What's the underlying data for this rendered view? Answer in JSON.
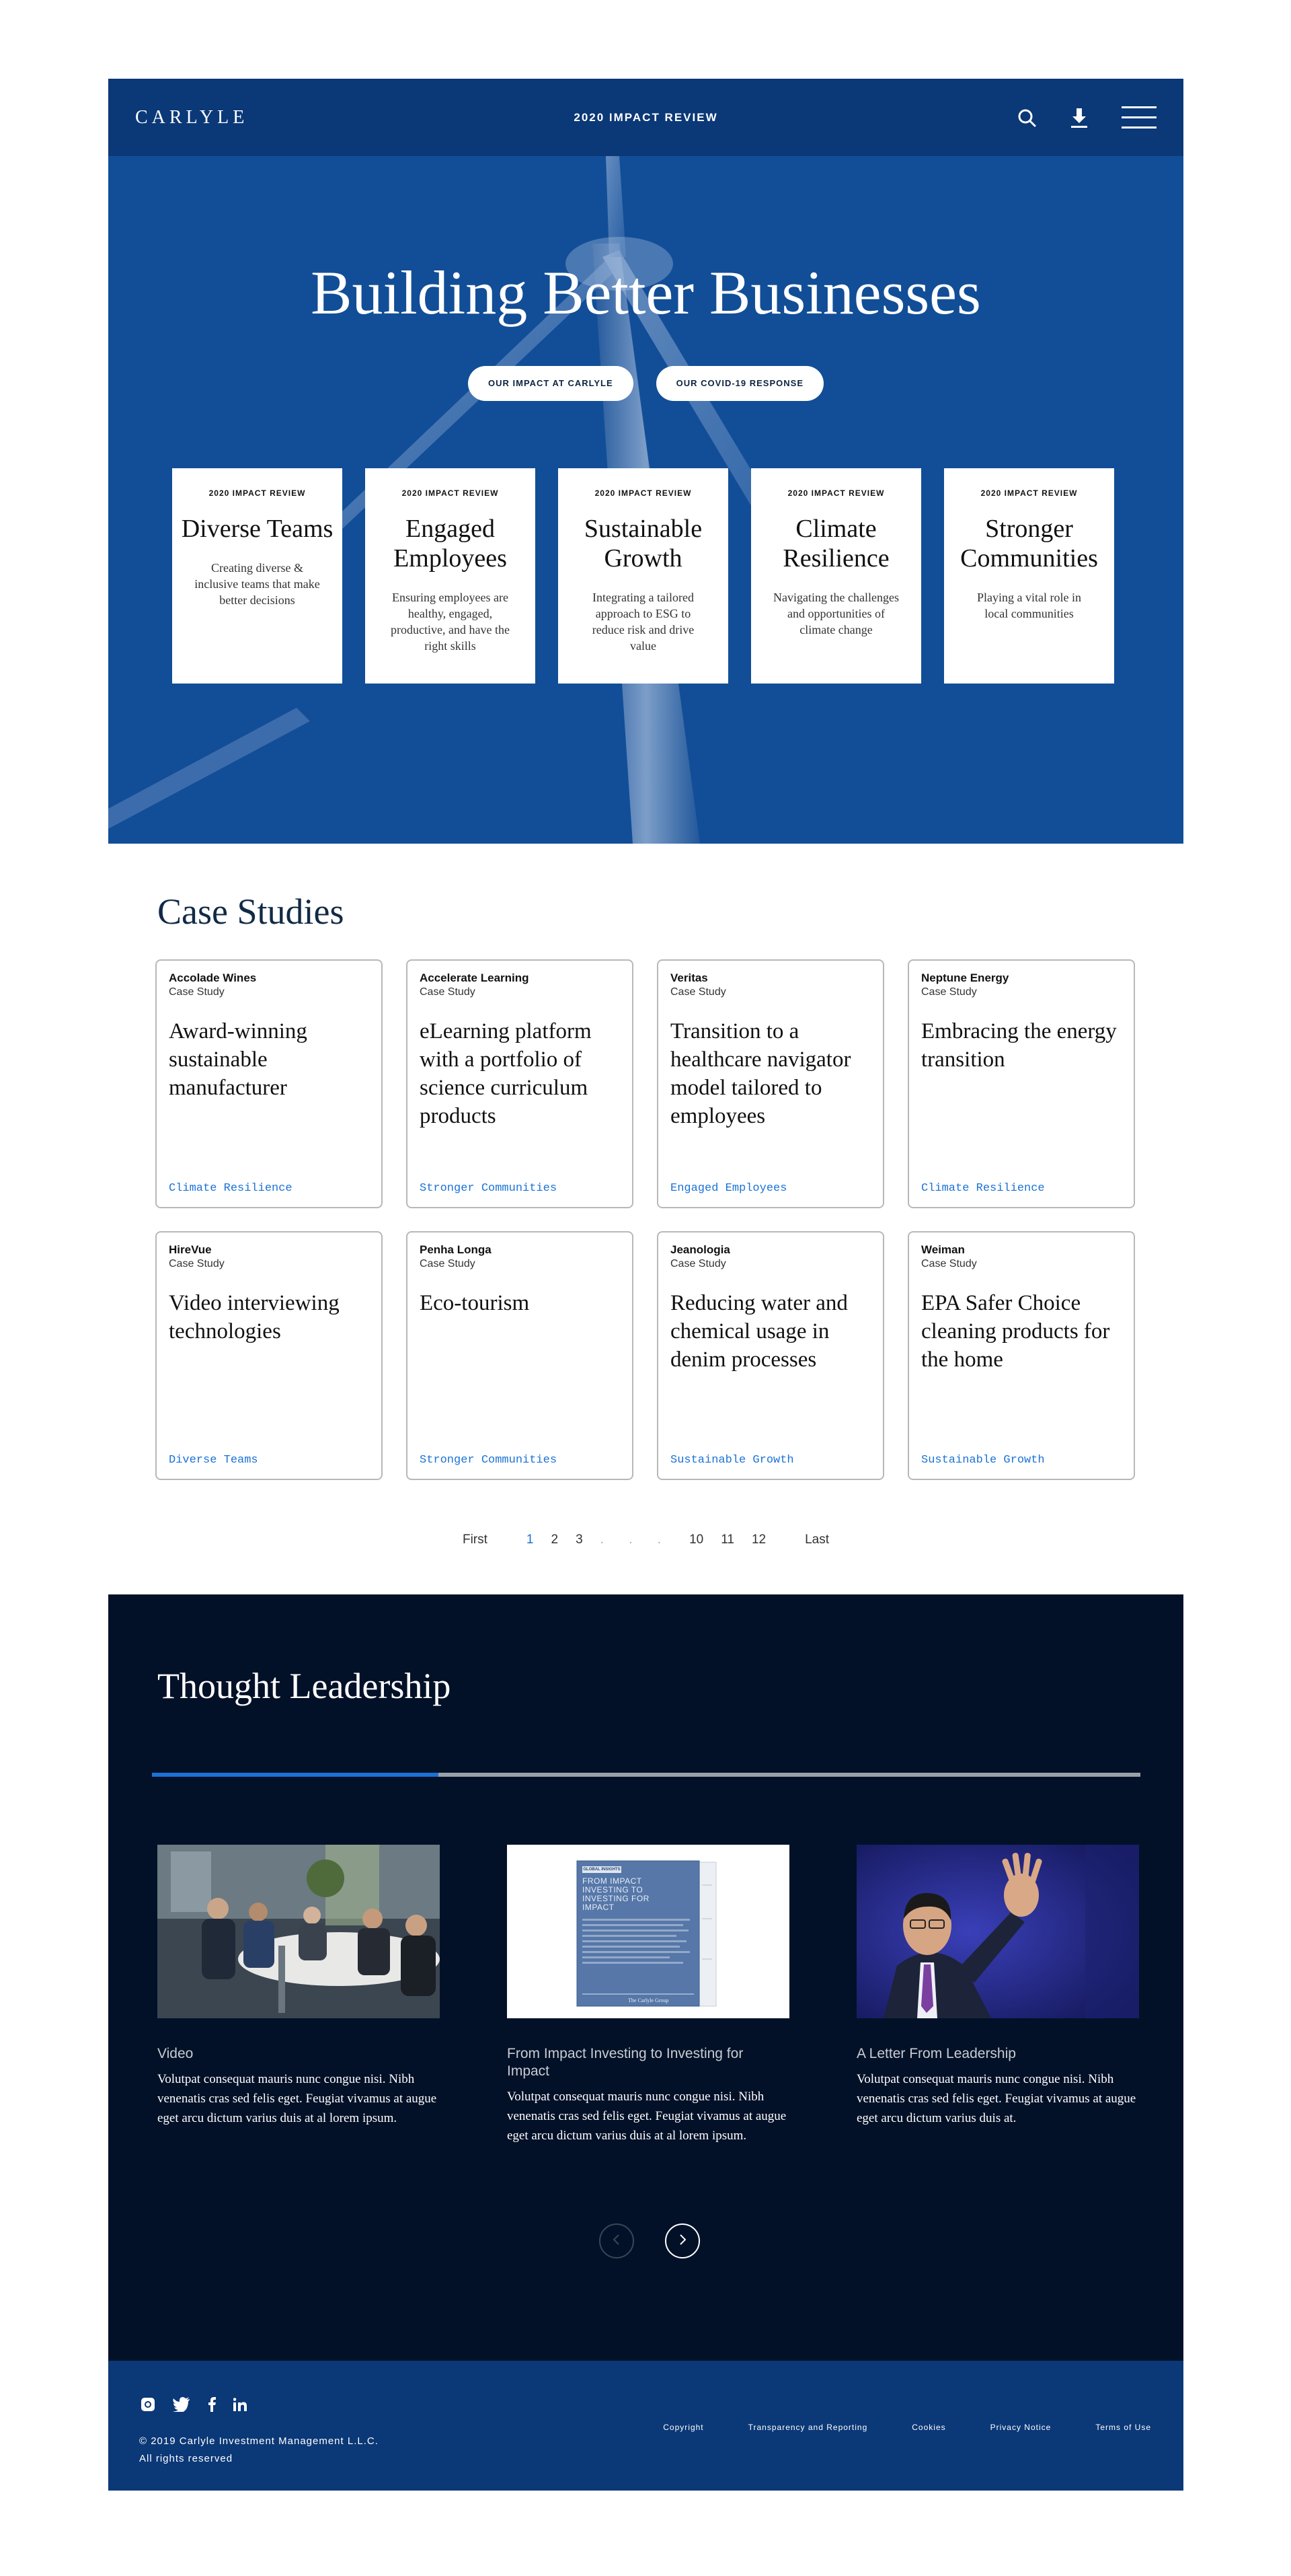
{
  "header": {
    "logo": "CARLYLE",
    "title": "2020 IMPACT REVIEW",
    "icons": [
      "search-icon",
      "download-icon",
      "menu-icon"
    ]
  },
  "hero": {
    "title": "Building Better Businesses",
    "buttons": [
      "OUR IMPACT AT CARLYLE",
      "OUR COVID-19 RESPONSE"
    ],
    "pillars": [
      {
        "kicker": "2020 IMPACT REVIEW",
        "title": "Diverse Teams",
        "desc": "Creating diverse & inclusive teams that make better decisions"
      },
      {
        "kicker": "2020 IMPACT REVIEW",
        "title": "Engaged Employees",
        "desc": "Ensuring employees are healthy, engaged, productive, and have the right skills"
      },
      {
        "kicker": "2020 IMPACT REVIEW",
        "title": "Sustainable Growth",
        "desc": "Integrating a tailored approach to ESG to reduce risk and drive value"
      },
      {
        "kicker": "2020 IMPACT REVIEW",
        "title": "Climate Resilience",
        "desc": "Navigating the challenges and opportunities of climate change"
      },
      {
        "kicker": "2020 IMPACT REVIEW",
        "title": "Stronger Communities",
        "desc": "Playing a vital role in local communities"
      }
    ]
  },
  "case_studies": {
    "title": "Case Studies",
    "cards": [
      {
        "company": "Accolade Wines",
        "type": "Case Study",
        "title": "Award-winning sustainable manufacturer",
        "tag": "Climate Resilience"
      },
      {
        "company": "Accelerate Learning",
        "type": "Case Study",
        "title": "eLearning platform with a portfolio of science curriculum products",
        "tag": "Stronger Communities"
      },
      {
        "company": "Veritas",
        "type": "Case Study",
        "title": "Transition to a healthcare navigator model tailored to employees",
        "tag": "Engaged Employees"
      },
      {
        "company": "Neptune Energy",
        "type": "Case Study",
        "title": "Embracing the energy transition",
        "tag": "Climate Resilience"
      },
      {
        "company": "HireVue",
        "type": "Case Study",
        "title": "Video interviewing technologies",
        "tag": "Diverse Teams"
      },
      {
        "company": "Penha Longa",
        "type": "Case Study",
        "title": "Eco-tourism",
        "tag": "Stronger Communities"
      },
      {
        "company": "Jeanologia",
        "type": "Case Study",
        "title": "Reducing water and chemical usage in denim processes",
        "tag": "Sustainable Growth"
      },
      {
        "company": "Weiman",
        "type": "Case Study",
        "title": "EPA Safer Choice cleaning products for the home",
        "tag": "Sustainable Growth"
      }
    ],
    "pagination": {
      "first": "First",
      "pages_start": [
        "1",
        "2",
        "3"
      ],
      "dots": ". . .",
      "pages_end": [
        "10",
        "11",
        "12"
      ],
      "last": "Last",
      "current": "1"
    }
  },
  "thought_leadership": {
    "title": "Thought Leadership",
    "progress": 0.29,
    "cards": [
      {
        "label": "Video",
        "text": "Volutpat consequat mauris nunc congue nisi. Nibh venenatis cras sed felis eget. Feugiat vivamus at augue eget arcu dictum varius duis at al lorem ipsum."
      },
      {
        "label": "From Impact Investing to Investing for Impact",
        "text": "Volutpat consequat mauris nunc congue nisi. Nibh venenatis cras sed felis eget. Feugiat vivamus at augue eget arcu dictum varius duis at al lorem ipsum."
      },
      {
        "label": "A Letter From Leadership",
        "text": "Volutpat consequat mauris nunc congue nisi. Nibh venenatis cras sed felis eget. Feugiat vivamus at augue eget arcu dictum varius duis at."
      }
    ],
    "report_cover": {
      "badge": "GLOBAL INSIGHTS",
      "title": "FROM IMPACT INVESTING TO INVESTING FOR IMPACT",
      "publisher": "The Carlyle Group"
    }
  },
  "footer": {
    "social_icons": [
      "instagram-icon",
      "twitter-icon",
      "facebook-icon",
      "linkedin-icon"
    ],
    "copyright_line1": "© 2019 Carlyle Investment Management L.L.C.",
    "copyright_line2": "All rights reserved",
    "links": [
      "Copyright",
      "Transparency and Reporting",
      "Cookies",
      "Privacy Notice",
      "Terms of Use"
    ]
  },
  "colors": {
    "header_blue": "#0b3877",
    "hero_blue": "#14509a",
    "accent": "#1b72d6",
    "dark_navy": "#031128"
  }
}
